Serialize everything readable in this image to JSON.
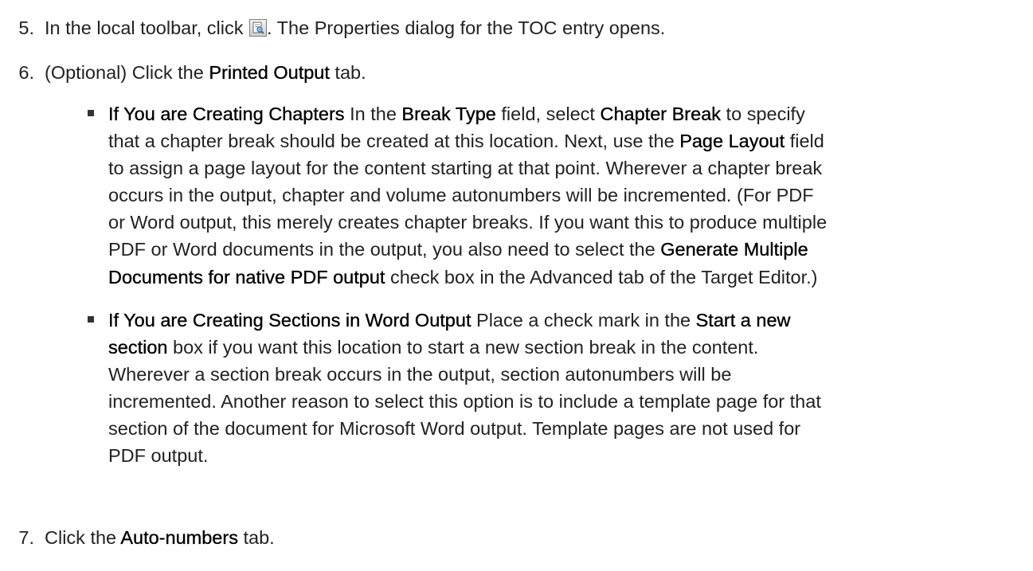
{
  "steps": [
    {
      "num": "5.",
      "parts": [
        "In the local toolbar, click ",
        ". The Properties dialog for the TOC entry opens."
      ],
      "icon": "properties-icon"
    },
    {
      "num": "6.",
      "parts": [
        "(Optional) Click the ",
        "Printed Output",
        " tab."
      ]
    },
    {
      "num": "7.",
      "parts": [
        "Click the ",
        "Auto-numbers",
        " tab."
      ]
    }
  ],
  "bullets": [
    {
      "lines": [
        [
          "If You are Creating Chapters",
          " In the ",
          "Break Type",
          " field, select ",
          "Chapter Break",
          " to specify"
        ],
        [
          "that a chapter break should be created at this location. Next, use the ",
          "Page Layout",
          " field"
        ],
        [
          "to assign a page layout for the content starting at that point. Wherever a chapter break"
        ],
        [
          "occurs in the output, chapter and volume autonumbers will be incremented. (For PDF"
        ],
        [
          "or Word output, this merely creates chapter breaks. If you want this to produce multiple"
        ],
        [
          "PDF or Word documents in the output, you also need to select the ",
          "Generate Multiple"
        ],
        [
          "Documents for native PDF output",
          " check box in the Advanced tab of the Target Editor.)"
        ]
      ]
    },
    {
      "lines": [
        [
          "If You are Creating Sections in Word Output",
          " Place a check mark in the ",
          "Start a new"
        ],
        [
          "section",
          " box if you want this location to start a new section break in the content."
        ],
        [
          "Wherever a section break occurs in the output, section autonumbers will be"
        ],
        [
          "incremented. Another reason to select this option is to include a template page for that"
        ],
        [
          "section of the document for Microsoft Word output. Template pages are not used for"
        ],
        [
          "PDF output."
        ]
      ]
    }
  ]
}
